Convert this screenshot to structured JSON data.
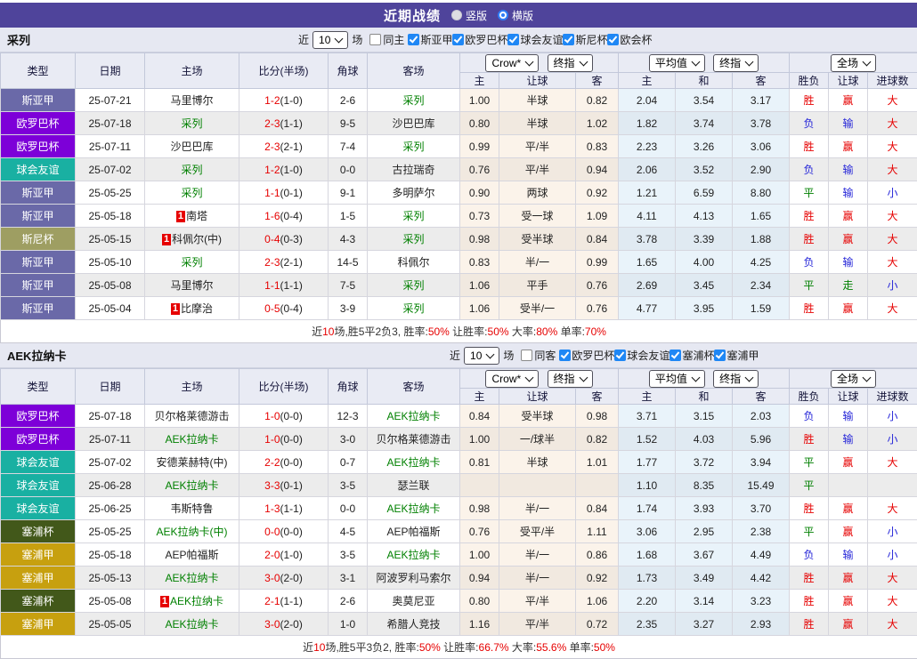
{
  "title_bar": {
    "title": "近期战绩",
    "layout_options": [
      {
        "label": "竖版",
        "selected": false
      },
      {
        "label": "横版",
        "selected": true
      }
    ]
  },
  "column_headers": {
    "left": [
      "类型",
      "日期",
      "主场",
      "比分(半场)",
      "角球",
      "客场"
    ],
    "odds_sub": [
      "主",
      "让球",
      "客"
    ],
    "avg_sub": [
      "主",
      "和",
      "客"
    ],
    "result_sub": [
      "胜负",
      "让球",
      "进球数"
    ]
  },
  "league_colors": {
    "斯亚甲": "#6A69A8",
    "欧罗巴杯": "#7D00D8",
    "球会友谊": "#19B0A2",
    "斯尼杯": "#9E9E62",
    "欧会杯": "#777799",
    "塞浦杯": "#42581A",
    "塞浦甲": "#C7A00F"
  },
  "outcome_colors": {
    "胜": "#E60000",
    "平": "#008000",
    "负": "#2626D8",
    "赢": "#E60000",
    "走": "#008000",
    "输": "#2626D8",
    "大": "#E60000",
    "小": "#2626D8"
  },
  "accent": {
    "focus_team_color": "#008000",
    "score_color": "#E60000",
    "card_badge_bg": "#E60000",
    "checkbox_blue": "#1F87F5",
    "titlebar_purple": "#4F449B"
  },
  "sections": [
    {
      "team": "采列",
      "filter": {
        "near_label": "近",
        "count": "10",
        "games_label": "场",
        "same_side_label": "同主",
        "same_side_checked": false,
        "leagues": [
          {
            "label": "斯亚甲",
            "checked": true
          },
          {
            "label": "欧罗巴杯",
            "checked": true
          },
          {
            "label": "球会友谊",
            "checked": true
          },
          {
            "label": "斯尼杯",
            "checked": true
          },
          {
            "label": "欧会杯",
            "checked": true
          }
        ]
      },
      "selectors": {
        "odds_source": "Crow*",
        "odds_stage": "终指",
        "avg_source": "平均值",
        "avg_stage": "终指",
        "scope": "全场"
      },
      "rows": [
        {
          "league": "斯亚甲",
          "date": "25-07-21",
          "home": "马里博尔",
          "home_focus": false,
          "home_card": false,
          "score": "1-2",
          "half": "(1-0)",
          "corner": "2-6",
          "away": "采列",
          "away_focus": true,
          "away_card": false,
          "odds": [
            "1.00",
            "半球",
            "0.82"
          ],
          "avg": [
            "2.04",
            "3.54",
            "3.17"
          ],
          "outcome": [
            "胜",
            "赢",
            "大"
          ],
          "shade": false
        },
        {
          "league": "欧罗巴杯",
          "date": "25-07-18",
          "home": "采列",
          "home_focus": true,
          "home_card": false,
          "score": "2-3",
          "half": "(1-1)",
          "corner": "9-5",
          "away": "沙巴巴库",
          "away_focus": false,
          "away_card": false,
          "odds": [
            "0.80",
            "半球",
            "1.02"
          ],
          "avg": [
            "1.82",
            "3.74",
            "3.78"
          ],
          "outcome": [
            "负",
            "输",
            "大"
          ],
          "shade": true
        },
        {
          "league": "欧罗巴杯",
          "date": "25-07-11",
          "home": "沙巴巴库",
          "home_focus": false,
          "home_card": false,
          "score": "2-3",
          "half": "(2-1)",
          "corner": "7-4",
          "away": "采列",
          "away_focus": true,
          "away_card": false,
          "odds": [
            "0.99",
            "平/半",
            "0.83"
          ],
          "avg": [
            "2.23",
            "3.26",
            "3.06"
          ],
          "outcome": [
            "胜",
            "赢",
            "大"
          ],
          "shade": false
        },
        {
          "league": "球会友谊",
          "date": "25-07-02",
          "home": "采列",
          "home_focus": true,
          "home_card": false,
          "score": "1-2",
          "half": "(1-0)",
          "corner": "0-0",
          "away": "古拉瑞奇",
          "away_focus": false,
          "away_card": false,
          "odds": [
            "0.76",
            "平/半",
            "0.94"
          ],
          "avg": [
            "2.06",
            "3.52",
            "2.90"
          ],
          "outcome": [
            "负",
            "输",
            "大"
          ],
          "shade": true
        },
        {
          "league": "斯亚甲",
          "date": "25-05-25",
          "home": "采列",
          "home_focus": true,
          "home_card": false,
          "score": "1-1",
          "half": "(0-1)",
          "corner": "9-1",
          "away": "多明萨尔",
          "away_focus": false,
          "away_card": false,
          "odds": [
            "0.90",
            "两球",
            "0.92"
          ],
          "avg": [
            "1.21",
            "6.59",
            "8.80"
          ],
          "outcome": [
            "平",
            "输",
            "小"
          ],
          "shade": false
        },
        {
          "league": "斯亚甲",
          "date": "25-05-18",
          "home": "南塔",
          "home_focus": false,
          "home_card": true,
          "score": "1-6",
          "half": "(0-4)",
          "corner": "1-5",
          "away": "采列",
          "away_focus": true,
          "away_card": false,
          "odds": [
            "0.73",
            "受一球",
            "1.09"
          ],
          "avg": [
            "4.11",
            "4.13",
            "1.65"
          ],
          "outcome": [
            "胜",
            "赢",
            "大"
          ],
          "shade": false
        },
        {
          "league": "斯尼杯",
          "date": "25-05-15",
          "home": "科佩尔(中)",
          "home_focus": false,
          "home_card": true,
          "score": "0-4",
          "half": "(0-3)",
          "corner": "4-3",
          "away": "采列",
          "away_focus": true,
          "away_card": false,
          "odds": [
            "0.98",
            "受半球",
            "0.84"
          ],
          "avg": [
            "3.78",
            "3.39",
            "1.88"
          ],
          "outcome": [
            "胜",
            "赢",
            "大"
          ],
          "shade": true
        },
        {
          "league": "斯亚甲",
          "date": "25-05-10",
          "home": "采列",
          "home_focus": true,
          "home_card": false,
          "score": "2-3",
          "half": "(2-1)",
          "corner": "14-5",
          "away": "科佩尔",
          "away_focus": false,
          "away_card": false,
          "odds": [
            "0.83",
            "半/一",
            "0.99"
          ],
          "avg": [
            "1.65",
            "4.00",
            "4.25"
          ],
          "outcome": [
            "负",
            "输",
            "大"
          ],
          "shade": false
        },
        {
          "league": "斯亚甲",
          "date": "25-05-08",
          "home": "马里博尔",
          "home_focus": false,
          "home_card": false,
          "score": "1-1",
          "half": "(1-1)",
          "corner": "7-5",
          "away": "采列",
          "away_focus": true,
          "away_card": false,
          "odds": [
            "1.06",
            "平手",
            "0.76"
          ],
          "avg": [
            "2.69",
            "3.45",
            "2.34"
          ],
          "outcome": [
            "平",
            "走",
            "小"
          ],
          "shade": true
        },
        {
          "league": "斯亚甲",
          "date": "25-05-04",
          "home": "比摩治",
          "home_focus": false,
          "home_card": true,
          "score": "0-5",
          "half": "(0-4)",
          "corner": "3-9",
          "away": "采列",
          "away_focus": true,
          "away_card": false,
          "odds": [
            "1.06",
            "受半/一",
            "0.76"
          ],
          "avg": [
            "4.77",
            "3.95",
            "1.59"
          ],
          "outcome": [
            "胜",
            "赢",
            "大"
          ],
          "shade": false
        }
      ],
      "summary": [
        {
          "text": "近",
          "red": false
        },
        {
          "text": "10",
          "red": true
        },
        {
          "text": "场,胜5平2负3, 胜率:",
          "red": false
        },
        {
          "text": "50%",
          "red": true
        },
        {
          "text": " 让胜率:",
          "red": false
        },
        {
          "text": "50%",
          "red": true
        },
        {
          "text": " 大率:",
          "red": false
        },
        {
          "text": "80%",
          "red": true
        },
        {
          "text": " 单率:",
          "red": false
        },
        {
          "text": "70%",
          "red": true
        }
      ]
    },
    {
      "team": "AEK拉纳卡",
      "filter": {
        "near_label": "近",
        "count": "10",
        "games_label": "场",
        "same_side_label": "同客",
        "same_side_checked": false,
        "leagues": [
          {
            "label": "欧罗巴杯",
            "checked": true
          },
          {
            "label": "球会友谊",
            "checked": true
          },
          {
            "label": "塞浦杯",
            "checked": true
          },
          {
            "label": "塞浦甲",
            "checked": true
          }
        ]
      },
      "selectors": {
        "odds_source": "Crow*",
        "odds_stage": "终指",
        "avg_source": "平均值",
        "avg_stage": "终指",
        "scope": "全场"
      },
      "rows": [
        {
          "league": "欧罗巴杯",
          "date": "25-07-18",
          "home": "贝尔格莱德游击",
          "home_focus": false,
          "home_card": false,
          "score": "1-0",
          "half": "(0-0)",
          "corner": "12-3",
          "away": "AEK拉纳卡",
          "away_focus": true,
          "away_card": false,
          "odds": [
            "0.84",
            "受半球",
            "0.98"
          ],
          "avg": [
            "3.71",
            "3.15",
            "2.03"
          ],
          "outcome": [
            "负",
            "输",
            "小"
          ],
          "shade": false
        },
        {
          "league": "欧罗巴杯",
          "date": "25-07-11",
          "home": "AEK拉纳卡",
          "home_focus": true,
          "home_card": false,
          "score": "1-0",
          "half": "(0-0)",
          "corner": "3-0",
          "away": "贝尔格莱德游击",
          "away_focus": false,
          "away_card": false,
          "odds": [
            "1.00",
            "一/球半",
            "0.82"
          ],
          "avg": [
            "1.52",
            "4.03",
            "5.96"
          ],
          "outcome": [
            "胜",
            "输",
            "小"
          ],
          "shade": true
        },
        {
          "league": "球会友谊",
          "date": "25-07-02",
          "home": "安德莱赫特(中)",
          "home_focus": false,
          "home_card": false,
          "score": "2-2",
          "half": "(0-0)",
          "corner": "0-7",
          "away": "AEK拉纳卡",
          "away_focus": true,
          "away_card": false,
          "odds": [
            "0.81",
            "半球",
            "1.01"
          ],
          "avg": [
            "1.77",
            "3.72",
            "3.94"
          ],
          "outcome": [
            "平",
            "赢",
            "大"
          ],
          "shade": false
        },
        {
          "league": "球会友谊",
          "date": "25-06-28",
          "home": "AEK拉纳卡",
          "home_focus": true,
          "home_card": false,
          "score": "3-3",
          "half": "(0-1)",
          "corner": "3-5",
          "away": "瑟兰联",
          "away_focus": false,
          "away_card": false,
          "odds": [
            "",
            "",
            ""
          ],
          "avg": [
            "1.10",
            "8.35",
            "15.49"
          ],
          "outcome": [
            "平",
            "",
            ""
          ],
          "shade": true
        },
        {
          "league": "球会友谊",
          "date": "25-06-25",
          "home": "韦斯特鲁",
          "home_focus": false,
          "home_card": false,
          "score": "1-3",
          "half": "(1-1)",
          "corner": "0-0",
          "away": "AEK拉纳卡",
          "away_focus": true,
          "away_card": false,
          "odds": [
            "0.98",
            "半/一",
            "0.84"
          ],
          "avg": [
            "1.74",
            "3.93",
            "3.70"
          ],
          "outcome": [
            "胜",
            "赢",
            "大"
          ],
          "shade": false
        },
        {
          "league": "塞浦杯",
          "date": "25-05-25",
          "home": "AEK拉纳卡(中)",
          "home_focus": true,
          "home_card": false,
          "score": "0-0",
          "half": "(0-0)",
          "corner": "4-5",
          "away": "AEP帕福斯",
          "away_focus": false,
          "away_card": false,
          "odds": [
            "0.76",
            "受平/半",
            "1.11"
          ],
          "avg": [
            "3.06",
            "2.95",
            "2.38"
          ],
          "outcome": [
            "平",
            "赢",
            "小"
          ],
          "shade": false
        },
        {
          "league": "塞浦甲",
          "date": "25-05-18",
          "home": "AEP帕福斯",
          "home_focus": false,
          "home_card": false,
          "score": "2-0",
          "half": "(1-0)",
          "corner": "3-5",
          "away": "AEK拉纳卡",
          "away_focus": true,
          "away_card": false,
          "odds": [
            "1.00",
            "半/一",
            "0.86"
          ],
          "avg": [
            "1.68",
            "3.67",
            "4.49"
          ],
          "outcome": [
            "负",
            "输",
            "小"
          ],
          "shade": false
        },
        {
          "league": "塞浦甲",
          "date": "25-05-13",
          "home": "AEK拉纳卡",
          "home_focus": true,
          "home_card": false,
          "score": "3-0",
          "half": "(2-0)",
          "corner": "3-1",
          "away": "阿波罗利马索尔",
          "away_focus": false,
          "away_card": false,
          "odds": [
            "0.94",
            "半/一",
            "0.92"
          ],
          "avg": [
            "1.73",
            "3.49",
            "4.42"
          ],
          "outcome": [
            "胜",
            "赢",
            "大"
          ],
          "shade": true
        },
        {
          "league": "塞浦杯",
          "date": "25-05-08",
          "home": "AEK拉纳卡",
          "home_focus": true,
          "home_card": true,
          "score": "2-1",
          "half": "(1-1)",
          "corner": "2-6",
          "away": "奥莫尼亚",
          "away_focus": false,
          "away_card": false,
          "odds": [
            "0.80",
            "平/半",
            "1.06"
          ],
          "avg": [
            "2.20",
            "3.14",
            "3.23"
          ],
          "outcome": [
            "胜",
            "赢",
            "大"
          ],
          "shade": false
        },
        {
          "league": "塞浦甲",
          "date": "25-05-05",
          "home": "AEK拉纳卡",
          "home_focus": true,
          "home_card": false,
          "score": "3-0",
          "half": "(2-0)",
          "corner": "1-0",
          "away": "希腊人竞技",
          "away_focus": false,
          "away_card": false,
          "odds": [
            "1.16",
            "平/半",
            "0.72"
          ],
          "avg": [
            "2.35",
            "3.27",
            "2.93"
          ],
          "outcome": [
            "胜",
            "赢",
            "大"
          ],
          "shade": true
        }
      ],
      "summary": [
        {
          "text": "近",
          "red": false
        },
        {
          "text": "10",
          "red": true
        },
        {
          "text": "场,胜5平3负2, 胜率:",
          "red": false
        },
        {
          "text": "50%",
          "red": true
        },
        {
          "text": " 让胜率:",
          "red": false
        },
        {
          "text": "66.7%",
          "red": true
        },
        {
          "text": " 大率:",
          "red": false
        },
        {
          "text": "55.6%",
          "red": true
        },
        {
          "text": " 单率:",
          "red": false
        },
        {
          "text": "50%",
          "red": true
        }
      ]
    }
  ]
}
